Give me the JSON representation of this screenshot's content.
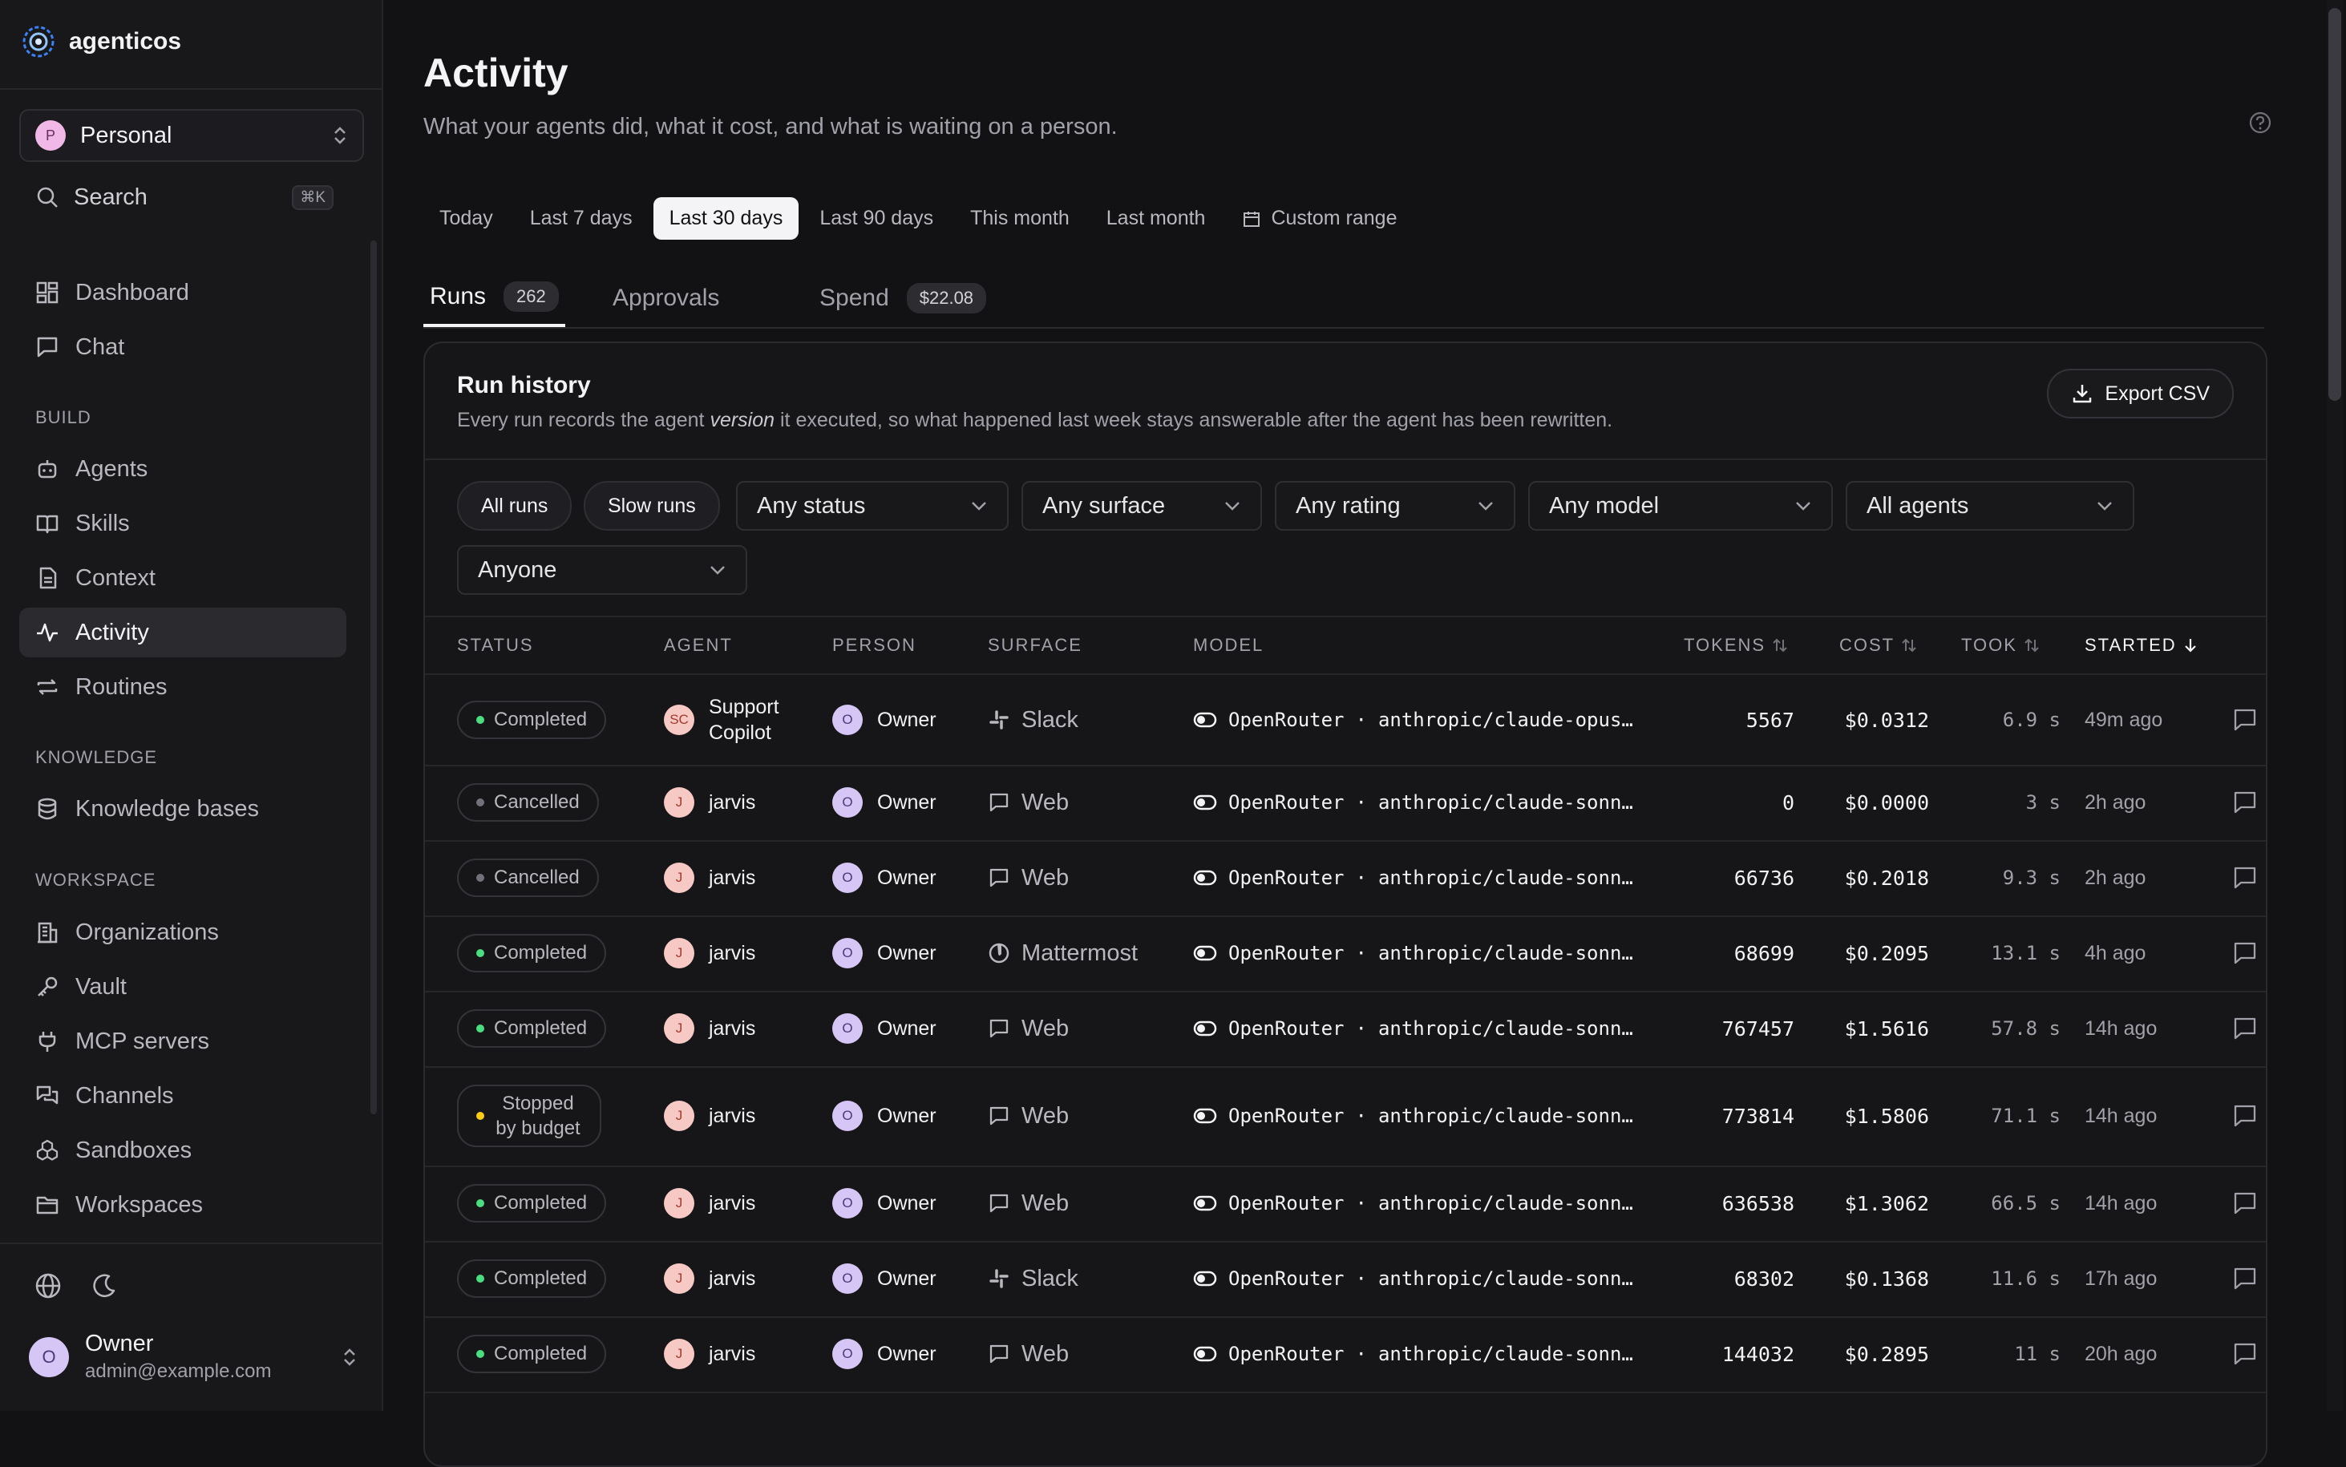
{
  "app": {
    "name": "agenticos"
  },
  "sidebar": {
    "workspace": {
      "initial": "P",
      "name": "Personal"
    },
    "search": {
      "label": "Search",
      "shortcut": "⌘K"
    },
    "items_top": [
      {
        "label": "Dashboard",
        "icon": "dashboard-icon"
      },
      {
        "label": "Chat",
        "icon": "chat-icon"
      }
    ],
    "sections": {
      "build": "BUILD",
      "knowledge": "KNOWLEDGE",
      "workspace": "WORKSPACE"
    },
    "build_items": [
      {
        "label": "Agents",
        "icon": "robot-icon"
      },
      {
        "label": "Skills",
        "icon": "book-icon"
      },
      {
        "label": "Context",
        "icon": "document-icon"
      },
      {
        "label": "Activity",
        "icon": "activity-icon",
        "active": true
      },
      {
        "label": "Routines",
        "icon": "repeat-icon"
      }
    ],
    "knowledge_items": [
      {
        "label": "Knowledge bases",
        "icon": "database-icon"
      }
    ],
    "workspace_items": [
      {
        "label": "Organizations",
        "icon": "building-icon"
      },
      {
        "label": "Vault",
        "icon": "key-icon"
      },
      {
        "label": "MCP servers",
        "icon": "plug-icon"
      },
      {
        "label": "Channels",
        "icon": "channels-icon"
      },
      {
        "label": "Sandboxes",
        "icon": "sandbox-icon"
      },
      {
        "label": "Workspaces",
        "icon": "folder-icon"
      }
    ],
    "user": {
      "initial": "O",
      "name": "Owner",
      "email": "admin@example.com"
    }
  },
  "page": {
    "title": "Activity",
    "subtitle": "What your agents did, what it cost, and what is waiting on a person."
  },
  "ranges": [
    "Today",
    "Last 7 days",
    "Last 30 days",
    "Last 90 days",
    "This month",
    "Last month",
    "Custom range"
  ],
  "active_range": "Last 30 days",
  "tabs": [
    {
      "label": "Runs",
      "badge": "262"
    },
    {
      "label": "Approvals"
    },
    {
      "label": "Spend",
      "badge": "$22.08"
    }
  ],
  "card": {
    "title": "Run history",
    "desc_before": "Every run records the agent ",
    "desc_em": "version",
    "desc_after": " it executed, so what happened last week stays answerable after the agent has been rewritten.",
    "export_label": "Export CSV"
  },
  "filters": {
    "chips": [
      "All runs",
      "Slow runs"
    ],
    "selects": [
      "Any status",
      "Any surface",
      "Any rating",
      "Any model",
      "All agents",
      "Anyone"
    ]
  },
  "columns": [
    "STATUS",
    "AGENT",
    "PERSON",
    "SURFACE",
    "MODEL",
    "TOKENS",
    "COST",
    "TOOK",
    "STARTED"
  ],
  "status_colors": {
    "Completed": "#4ade80",
    "Cancelled": "#71717a",
    "Stopped by budget": "#facc15"
  },
  "rows": [
    {
      "status": "Completed",
      "agent_initial": "SC",
      "agent": "Support Copilot",
      "person_initial": "O",
      "person": "Owner",
      "surface": "Slack",
      "surface_icon": "slack-icon",
      "provider": "OpenRouter",
      "model": "anthropic/claude-opus…",
      "tokens": "5567",
      "cost": "$0.0312",
      "took": "6.9 s",
      "started": "49m ago"
    },
    {
      "status": "Cancelled",
      "agent_initial": "J",
      "agent": "jarvis",
      "person_initial": "O",
      "person": "Owner",
      "surface": "Web",
      "surface_icon": "web-chat-icon",
      "provider": "OpenRouter",
      "model": "anthropic/claude-sonn…",
      "tokens": "0",
      "cost": "$0.0000",
      "took": "3 s",
      "started": "2h ago"
    },
    {
      "status": "Cancelled",
      "agent_initial": "J",
      "agent": "jarvis",
      "person_initial": "O",
      "person": "Owner",
      "surface": "Web",
      "surface_icon": "web-chat-icon",
      "provider": "OpenRouter",
      "model": "anthropic/claude-sonn…",
      "tokens": "66736",
      "cost": "$0.2018",
      "took": "9.3 s",
      "started": "2h ago"
    },
    {
      "status": "Completed",
      "agent_initial": "J",
      "agent": "jarvis",
      "person_initial": "O",
      "person": "Owner",
      "surface": "Mattermost",
      "surface_icon": "mattermost-icon",
      "provider": "OpenRouter",
      "model": "anthropic/claude-sonn…",
      "tokens": "68699",
      "cost": "$0.2095",
      "took": "13.1 s",
      "started": "4h ago"
    },
    {
      "status": "Completed",
      "agent_initial": "J",
      "agent": "jarvis",
      "person_initial": "O",
      "person": "Owner",
      "surface": "Web",
      "surface_icon": "web-chat-icon",
      "provider": "OpenRouter",
      "model": "anthropic/claude-sonn…",
      "tokens": "767457",
      "cost": "$1.5616",
      "took": "57.8 s",
      "started": "14h ago"
    },
    {
      "status": "Stopped by budget",
      "agent_initial": "J",
      "agent": "jarvis",
      "person_initial": "O",
      "person": "Owner",
      "surface": "Web",
      "surface_icon": "web-chat-icon",
      "provider": "OpenRouter",
      "model": "anthropic/claude-sonn…",
      "tokens": "773814",
      "cost": "$1.5806",
      "took": "71.1 s",
      "started": "14h ago"
    },
    {
      "status": "Completed",
      "agent_initial": "J",
      "agent": "jarvis",
      "person_initial": "O",
      "person": "Owner",
      "surface": "Web",
      "surface_icon": "web-chat-icon",
      "provider": "OpenRouter",
      "model": "anthropic/claude-sonn…",
      "tokens": "636538",
      "cost": "$1.3062",
      "took": "66.5 s",
      "started": "14h ago"
    },
    {
      "status": "Completed",
      "agent_initial": "J",
      "agent": "jarvis",
      "person_initial": "O",
      "person": "Owner",
      "surface": "Slack",
      "surface_icon": "slack-icon",
      "provider": "OpenRouter",
      "model": "anthropic/claude-sonn…",
      "tokens": "68302",
      "cost": "$0.1368",
      "took": "11.6 s",
      "started": "17h ago"
    },
    {
      "status": "Completed",
      "agent_initial": "J",
      "agent": "jarvis",
      "person_initial": "O",
      "person": "Owner",
      "surface": "Web",
      "surface_icon": "web-chat-icon",
      "provider": "OpenRouter",
      "model": "anthropic/claude-sonn…",
      "tokens": "144032",
      "cost": "$0.2895",
      "took": "11 s",
      "started": "20h ago"
    }
  ]
}
